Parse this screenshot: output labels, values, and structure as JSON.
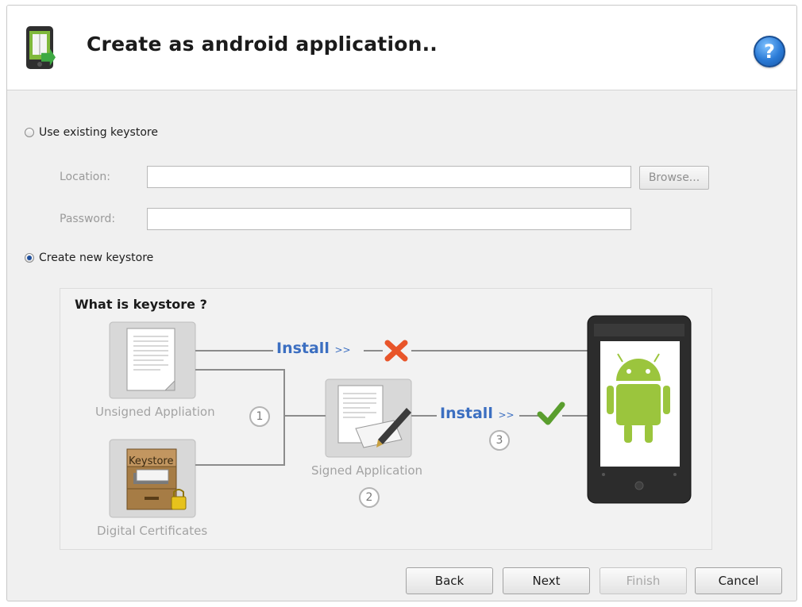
{
  "header": {
    "title": "Create as android application..",
    "help_label": "?"
  },
  "keystore_options": {
    "use_existing_label": "Use existing keystore",
    "use_existing_selected": false,
    "location_label": "Location:",
    "location_value": "",
    "browse_label": "Browse...",
    "password_label": "Password:",
    "password_value": "",
    "create_new_label": "Create new keystore",
    "create_new_selected": true
  },
  "diagram": {
    "title": "What is keystore ?",
    "unsigned_caption": "Unsigned Appliation",
    "certificates_caption": "Digital Certificates",
    "keystore_box_label": "Keystore",
    "signed_caption": "Signed Application",
    "install_label": "Install",
    "install_arrows": ">>",
    "step_1": "1",
    "step_2": "2",
    "step_3": "3"
  },
  "buttons": {
    "back": "Back",
    "next": "Next",
    "finish": "Finish",
    "cancel": "Cancel",
    "finish_enabled": false
  },
  "colors": {
    "accent_blue": "#3c6fc1",
    "android_green": "#9bc53d",
    "error_red": "#e8552a",
    "success_green": "#5a9e2e"
  }
}
